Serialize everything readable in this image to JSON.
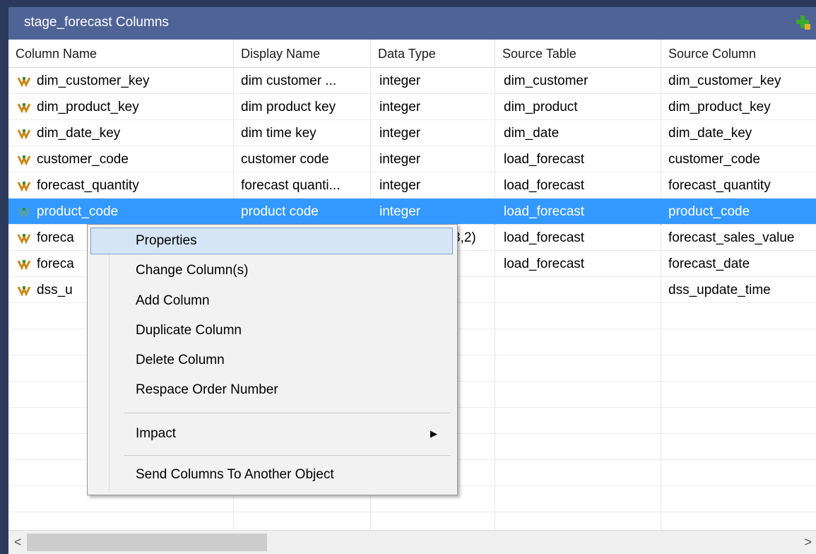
{
  "window": {
    "title": "stage_forecast Columns",
    "title_icon": "add-green-icon"
  },
  "columns": [
    {
      "label": "Column Name"
    },
    {
      "label": "Display Name"
    },
    {
      "label": "Data Type"
    },
    {
      "label": "Source Table"
    },
    {
      "label": "Source Column"
    }
  ],
  "rows": [
    {
      "name": "dim_customer_key",
      "display": "dim customer ...",
      "type": "integer",
      "table": "dim_customer",
      "source": "dim_customer_key",
      "selected": false
    },
    {
      "name": "dim_product_key",
      "display": "dim product key",
      "type": "integer",
      "table": "dim_product",
      "source": "dim_product_key",
      "selected": false
    },
    {
      "name": "dim_date_key",
      "display": "dim time key",
      "type": "integer",
      "table": "dim_date",
      "source": "dim_date_key",
      "selected": false
    },
    {
      "name": "customer_code",
      "display": "customer code",
      "type": "integer",
      "table": "load_forecast",
      "source": "customer_code",
      "selected": false
    },
    {
      "name": "forecast_quantity",
      "display": "forecast quanti...",
      "type": "integer",
      "table": "load_forecast",
      "source": "forecast_quantity",
      "selected": false
    },
    {
      "name": "product_code",
      "display": "product code",
      "type": "integer",
      "table": "load_forecast",
      "source": "product_code",
      "selected": true
    },
    {
      "name": "foreca",
      "display": "",
      "type": "3,2)",
      "table": "load_forecast",
      "source": "forecast_sales_value",
      "selected": false
    },
    {
      "name": "foreca",
      "display": "",
      "type": "",
      "table": "load_forecast",
      "source": "forecast_date",
      "selected": false
    },
    {
      "name": "dss_u",
      "display": "",
      "type": "",
      "table": "",
      "source": "dss_update_time",
      "selected": false
    }
  ],
  "context_menu": {
    "items": [
      {
        "label": "Properties"
      },
      {
        "label": "Change Column(s)"
      },
      {
        "label": "Add Column"
      },
      {
        "label": "Duplicate Column"
      },
      {
        "label": "Delete Column"
      },
      {
        "label": "Respace Order Number"
      },
      {
        "label": "Impact"
      },
      {
        "label": "Send Columns To Another Object"
      }
    ],
    "submenu_arrow": "chevron-right-icon"
  },
  "scrollbar": {
    "left_arrow": "<",
    "right_arrow": ">"
  },
  "colors": {
    "titlebar": "#4f6396",
    "selection": "#3399ff",
    "menu_hover": "#d5e5f5"
  }
}
